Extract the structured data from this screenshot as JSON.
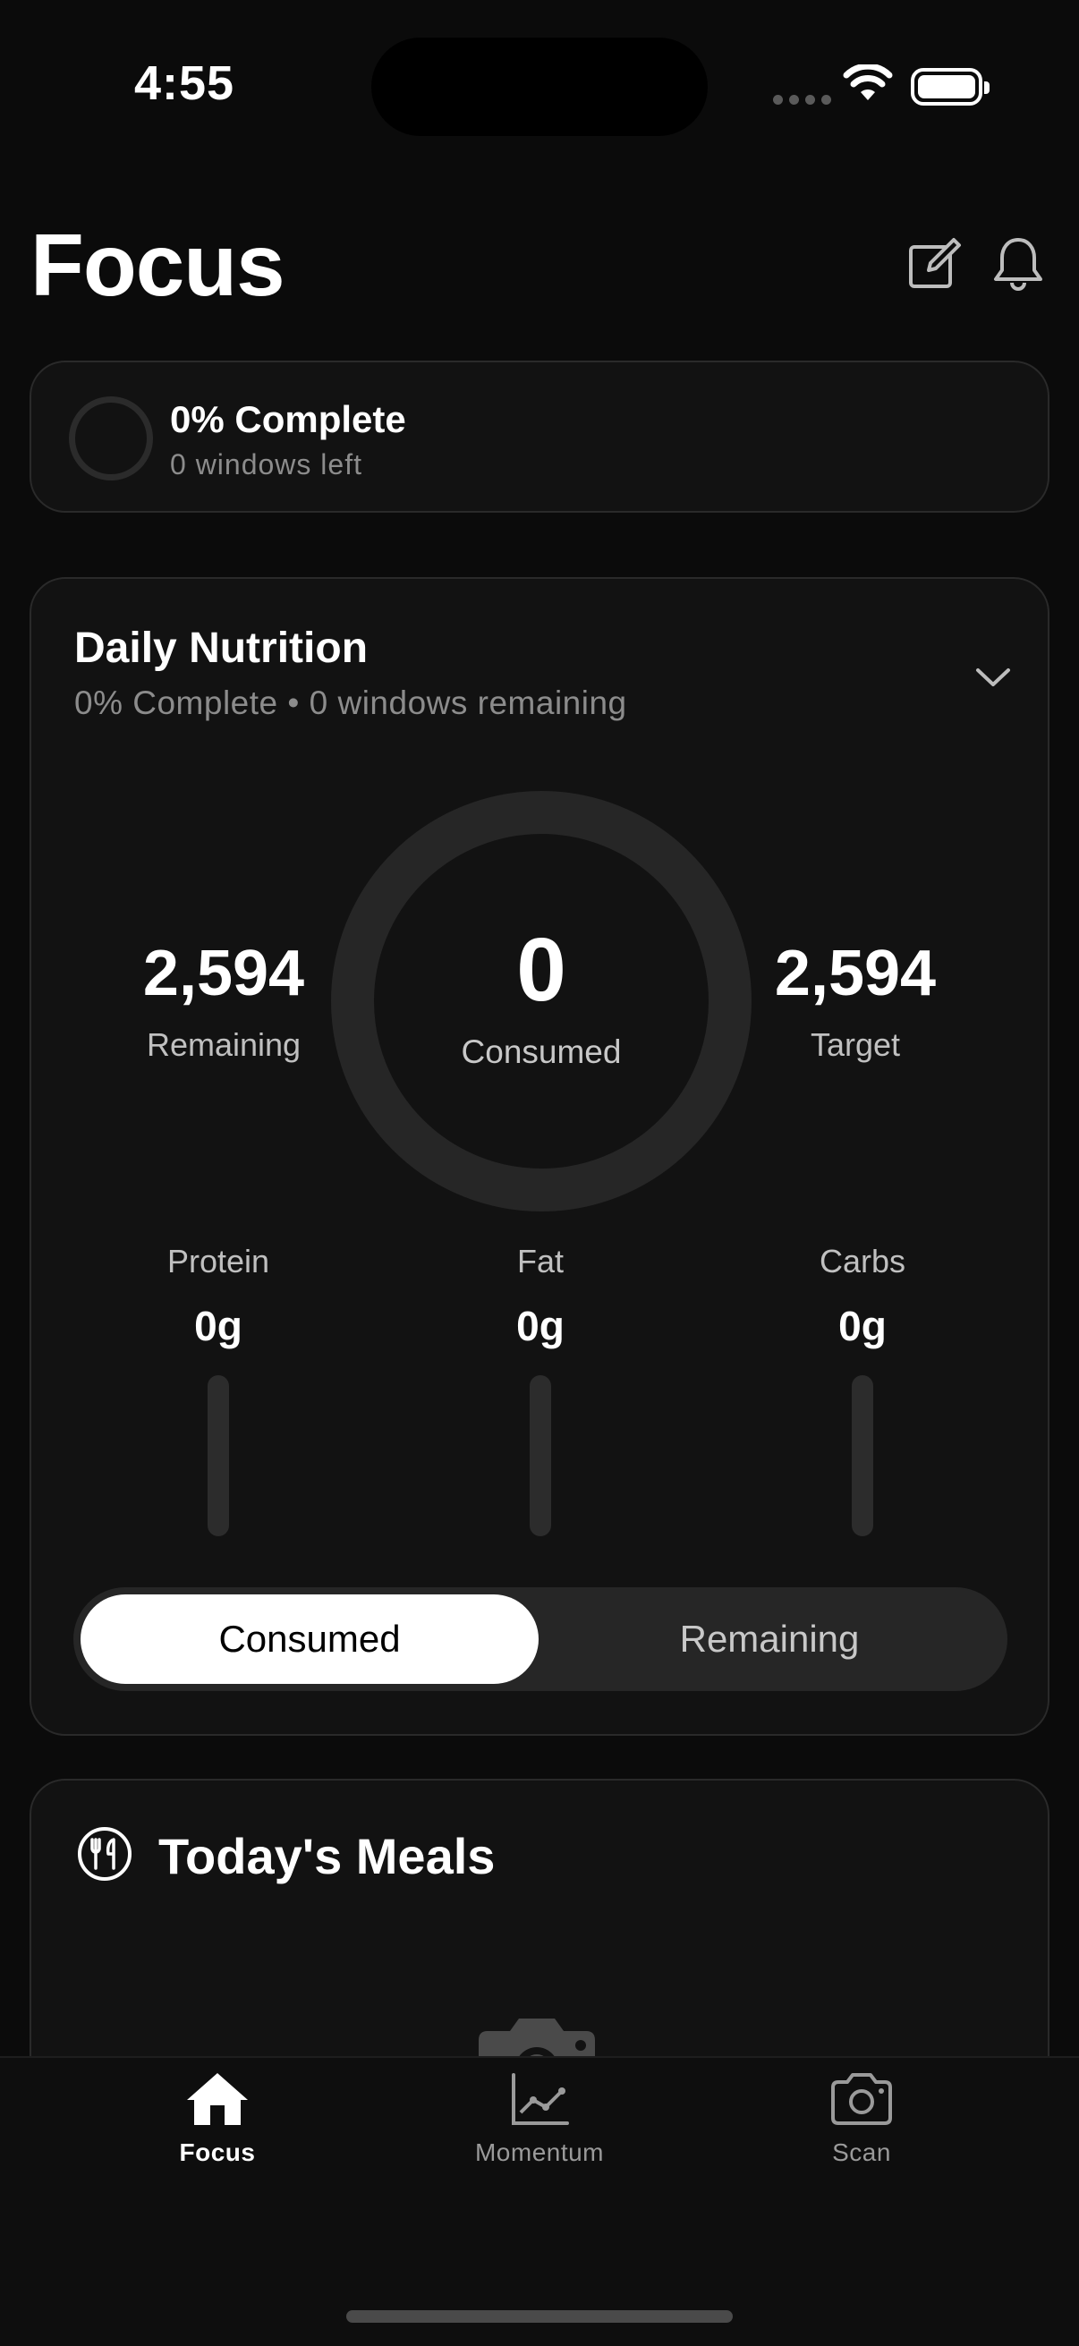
{
  "status": {
    "time": "4:55"
  },
  "header": {
    "title": "Focus",
    "icons": [
      "edit-icon",
      "bell-icon"
    ]
  },
  "progress_card": {
    "title": "0% Complete",
    "subtitle": "0 windows left",
    "progress": 0
  },
  "nutrition": {
    "title": "Daily Nutrition",
    "subtitle": "0% Complete • 0 windows remaining",
    "remaining_value": "2,594",
    "remaining_label": "Remaining",
    "consumed_value": "0",
    "consumed_label": "Consumed",
    "target_value": "2,594",
    "target_label": "Target",
    "macros": [
      {
        "name": "Protein",
        "value": "0g",
        "fill": 0
      },
      {
        "name": "Fat",
        "value": "0g",
        "fill": 0
      },
      {
        "name": "Carbs",
        "value": "0g",
        "fill": 0
      }
    ],
    "toggle": {
      "consumed": "Consumed",
      "remaining": "Remaining",
      "selected": "Consumed"
    }
  },
  "meals": {
    "title": "Today's Meals"
  },
  "tabbar": {
    "items": [
      {
        "label": "Focus",
        "icon": "home-icon",
        "active": true
      },
      {
        "label": "Momentum",
        "icon": "chart-icon",
        "active": false
      },
      {
        "label": "Scan",
        "icon": "camera-icon",
        "active": false
      }
    ]
  },
  "colors": {
    "background": "#0b0b0b",
    "card": "#121212",
    "ring": "#262626",
    "accent": "#ffffff"
  }
}
